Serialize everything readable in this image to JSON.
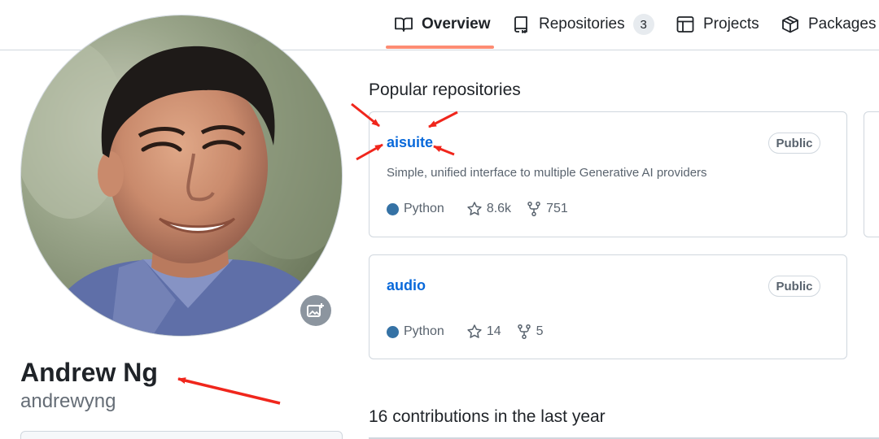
{
  "nav": {
    "tabs": [
      {
        "label": "Overview",
        "icon": "book-icon",
        "active": true
      },
      {
        "label": "Repositories",
        "icon": "repo-icon",
        "count": "3"
      },
      {
        "label": "Projects",
        "icon": "table-icon"
      },
      {
        "label": "Packages",
        "icon": "package-icon"
      }
    ],
    "active_color": "#fd8c73"
  },
  "profile": {
    "name": "Andrew Ng",
    "login": "andrewyng",
    "avatar": "profile-photo"
  },
  "popular": {
    "title": "Popular repositories",
    "repos": [
      {
        "name": "aisuite",
        "visibility": "Public",
        "description": "Simple, unified interface to multiple Generative AI providers",
        "language": "Python",
        "language_color": "#3572A5",
        "stars": "8.6k",
        "forks": "751"
      },
      {
        "name": "audio",
        "visibility": "Public",
        "description": "",
        "language": "Python",
        "language_color": "#3572A5",
        "stars": "14",
        "forks": "5"
      }
    ]
  },
  "contributions": {
    "title": "16 contributions in the last year"
  },
  "colors": {
    "link": "#0969da",
    "annotation_arrow": "#f0261c",
    "border": "#d0d7de"
  }
}
